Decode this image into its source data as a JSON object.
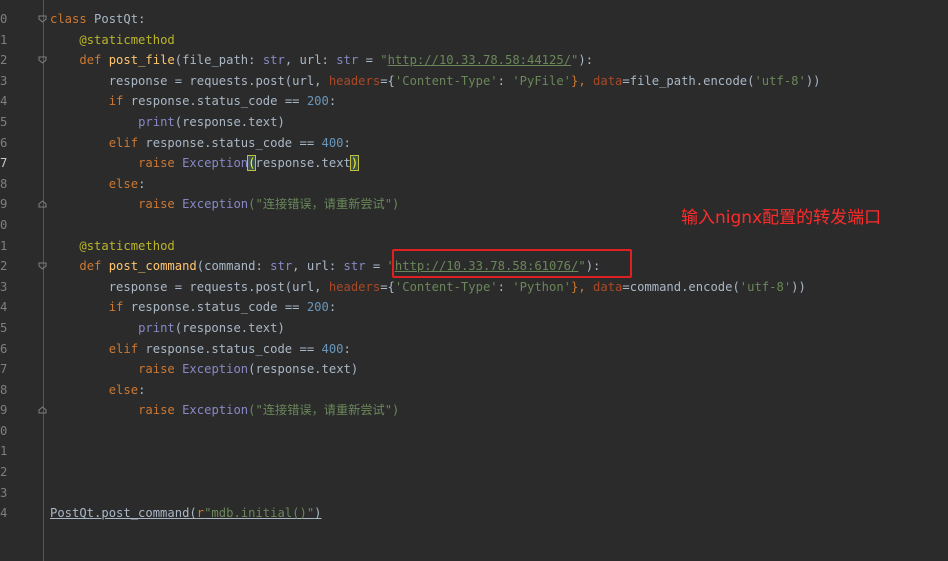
{
  "line_numbers": [
    "0",
    "1",
    "2",
    "3",
    "4",
    "5",
    "6",
    "7",
    "8",
    "9",
    "0",
    "1",
    "2",
    "3",
    "4",
    "5",
    "6",
    "7",
    "8",
    "9",
    "0",
    "1",
    "2",
    "3",
    "4"
  ],
  "annotation": {
    "text": "输入nignx配置的转发端口",
    "color": "#ff2b2b"
  },
  "code": {
    "class_kw": "class",
    "class_name": "PostQt",
    "colon": ":",
    "decorator": "@staticmethod",
    "def_kw": "def",
    "post_file": {
      "name": "post_file",
      "params_before": "(file_path: ",
      "type1": "str",
      "params_mid": ", url: ",
      "type2": "str",
      "eq": " = ",
      "quote_open": "\"",
      "url": "http://10.33.78.58:44125/",
      "quote_close": "\"",
      "close": "):",
      "response_lhs": "response = requests.post(url, ",
      "headers_kw": "headers",
      "headers_eq": "={",
      "ct_key": "'Content-Type'",
      "ct_colon": ": ",
      "ct_val": "'PyFile'",
      "headers_close": "}, ",
      "data_kw": "data",
      "data_rest": "=file_path.encode(",
      "enc": "'utf-8'",
      "end": "))"
    },
    "post_command": {
      "name": "post_command",
      "params_before": "(command: ",
      "type1": "str",
      "params_mid": ", url: ",
      "type2": "str",
      "eq": " = ",
      "quote_open": "\"",
      "url": "http://10.33.78.58:61076/",
      "quote_close": "\"",
      "close": "):",
      "response_lhs": "response = requests.post(url, ",
      "headers_kw": "headers",
      "headers_eq": "={",
      "ct_key": "'Content-Type'",
      "ct_colon": ": ",
      "ct_val": "'Python'",
      "headers_close": "}, ",
      "data_kw": "data",
      "data_rest": "=command.encode(",
      "enc": "'utf-8'",
      "end": "))"
    },
    "if_kw": "if",
    "if_rest": " response.status_code == ",
    "code_200": "200",
    "print_fn": "print",
    "print_rest": "(response.text)",
    "elif_kw": "elif",
    "elif_rest": " response.status_code == ",
    "code_400": "400",
    "raise_kw": "raise",
    "exception": "Exception",
    "paren_open": "(",
    "resp_text": "response.text",
    "paren_close": ")",
    "exc_rest": "(response.text)",
    "else_kw": "else",
    "err_msg": "(\"连接错误，请重新尝试\")",
    "call_prefix": "PostQt.post_command(",
    "call_r": "r",
    "call_str": "\"mdb.initial()\"",
    "call_close": ")"
  }
}
